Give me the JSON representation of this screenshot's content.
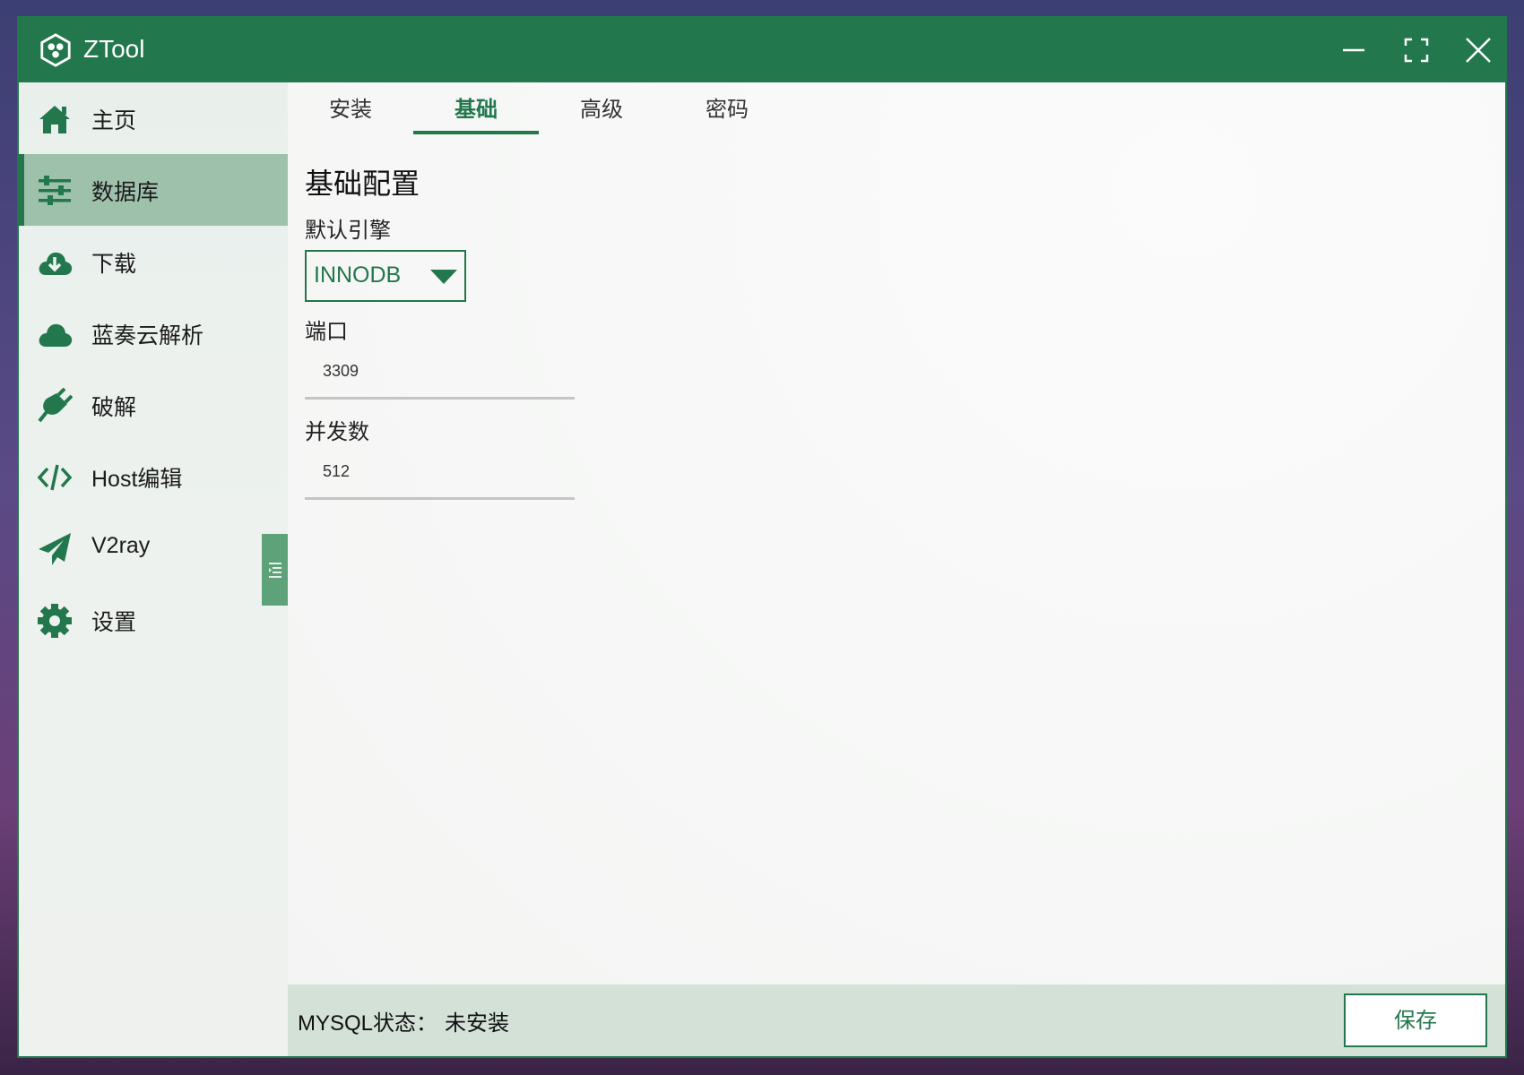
{
  "app": {
    "title": "ZTool",
    "accent": "#22774c"
  },
  "window_controls": {
    "minimize_icon": "minimize-icon",
    "maximize_icon": "maximize-icon",
    "close_icon": "close-icon"
  },
  "sidebar": {
    "items": [
      {
        "label": "主页",
        "icon": "home-icon",
        "active": false
      },
      {
        "label": "数据库",
        "icon": "sliders-icon",
        "active": true
      },
      {
        "label": "下载",
        "icon": "cloud-download-icon",
        "active": false
      },
      {
        "label": "蓝奏云解析",
        "icon": "cloud-icon",
        "active": false
      },
      {
        "label": "破解",
        "icon": "plug-icon",
        "active": false
      },
      {
        "label": "Host编辑",
        "icon": "code-icon",
        "active": false
      },
      {
        "label": "V2ray",
        "icon": "paper-plane-icon",
        "active": false
      },
      {
        "label": "设置",
        "icon": "gear-icon",
        "active": false
      }
    ]
  },
  "tabs": [
    {
      "label": "安装",
      "active": false
    },
    {
      "label": "基础",
      "active": true
    },
    {
      "label": "高级",
      "active": false
    },
    {
      "label": "密码",
      "active": false
    }
  ],
  "form": {
    "title": "基础配置",
    "engine": {
      "label": "默认引擎",
      "value": "INNODB"
    },
    "port": {
      "label": "端口",
      "value": "3309"
    },
    "concurrency": {
      "label": "并发数",
      "value": "512"
    }
  },
  "status": {
    "label": "MYSQL状态：",
    "value": "未安装",
    "save_label": "保存"
  }
}
